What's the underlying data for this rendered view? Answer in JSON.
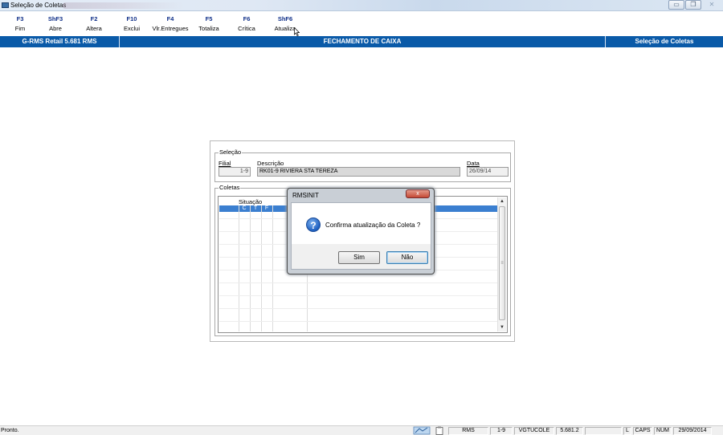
{
  "window": {
    "title": "Seleção de Coletas",
    "controls": {
      "minimize": "▭",
      "restore": "❐",
      "close": "✕"
    }
  },
  "toolbar": {
    "items": [
      {
        "key": "F3",
        "label": "Fim"
      },
      {
        "key": "ShF3",
        "label": "Abre"
      },
      {
        "key": "F2",
        "label": "Altera"
      },
      {
        "key": "F10",
        "label": "Exclui"
      },
      {
        "key": "F4",
        "label": "Vlr.Entregues"
      },
      {
        "key": "F5",
        "label": "Totaliza"
      },
      {
        "key": "F6",
        "label": "Crítica"
      },
      {
        "key": "ShF6",
        "label": "Atualiza"
      }
    ]
  },
  "header": {
    "app": "G-RMS Retail 5.681 RMS",
    "center": "FECHAMENTO DE CAIXA",
    "right": "Seleção de Coletas"
  },
  "selecao": {
    "legend": "Seleção",
    "filial_label": "Filial",
    "filial_value": "1-9",
    "descricao_label": "Descrição",
    "descricao_value": "RK01-9 RIVIERA STA TEREZA",
    "data_label": "Data",
    "data_value": "26/09/14"
  },
  "coletas": {
    "legend": "Coletas",
    "col_situacao": "Situação",
    "sub_cols": [
      "C",
      "T",
      "F"
    ],
    "scroll_grip": "≡"
  },
  "dialog": {
    "title": "RMSINIT",
    "close": "x",
    "icon": "?",
    "message": "Confirma atualização da Coleta ?",
    "yes": "Sim",
    "no": "Não"
  },
  "status": {
    "text": "Pronto.",
    "cells": [
      "RMS",
      "1-9",
      "VGTUCOLE",
      "5.681.2",
      "",
      "L",
      "CAPS",
      "NUM",
      "29/09/2014"
    ]
  },
  "colors": {
    "header_blue": "#0a5aa8",
    "toolbar_key": "#0f2f88",
    "selection": "#3b7fd0"
  }
}
